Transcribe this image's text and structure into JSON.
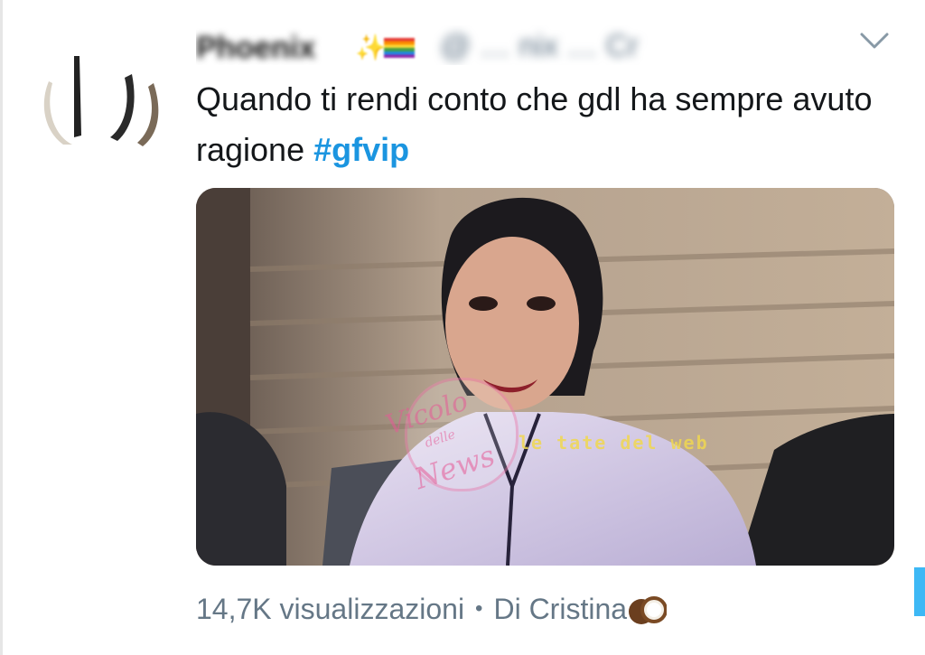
{
  "tweet": {
    "author_name": "Phoenix",
    "author_handle": "@ … nix … Cr",
    "name_emoji": "✨",
    "text_main": "Quando ti rendi conto che gdl ha sempre avuto ragione ",
    "hashtag": "#gfvip"
  },
  "media": {
    "watermark_vicolo": [
      "Vicolo",
      "delle",
      "News"
    ],
    "watermark_web": "le tate del web"
  },
  "footer": {
    "views": "14,7K visualizzazioni",
    "separator": "•",
    "credit": "Di Cristina"
  },
  "icons": {
    "caret": "chevron-down-icon",
    "coconut": "coconut-emoji-icon",
    "flag": "rainbow-flag-emoji"
  },
  "colors": {
    "hashtag": "#1b95e0",
    "text": "#14171a",
    "meta": "#657786",
    "progress": "#3db8f5"
  }
}
